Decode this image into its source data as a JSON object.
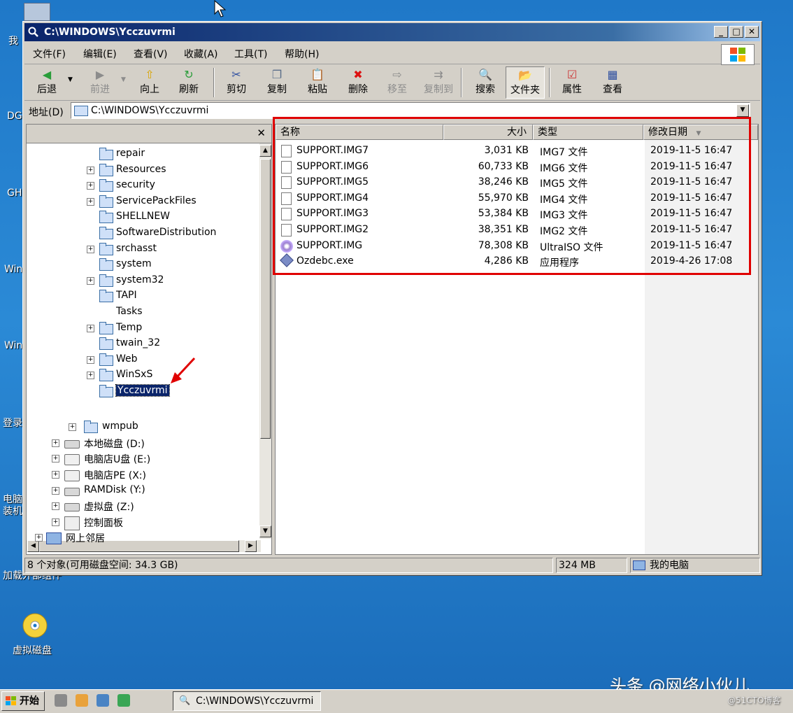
{
  "window": {
    "title": "C:\\WINDOWS\\Ycczuvrmi",
    "controls": {
      "minimize": "_",
      "maximize": "□",
      "close": "✕"
    }
  },
  "menu": [
    "文件(F)",
    "编辑(E)",
    "查看(V)",
    "收藏(A)",
    "工具(T)",
    "帮助(H)"
  ],
  "toolbar": {
    "back": "后退",
    "forward": "前进",
    "up": "向上",
    "refresh": "刷新",
    "cut": "剪切",
    "copy": "复制",
    "paste": "粘贴",
    "delete": "删除",
    "move_to": "移至",
    "copy_to": "复制到",
    "search": "搜索",
    "folders": "文件夹",
    "properties": "属性",
    "views": "查看"
  },
  "address": {
    "label": "地址(D)",
    "value": "C:\\WINDOWS\\Ycczuvrmi"
  },
  "tree": {
    "close": "✕",
    "items": [
      {
        "label": "repair",
        "expand": false
      },
      {
        "label": "Resources",
        "expand": true
      },
      {
        "label": "security",
        "expand": true
      },
      {
        "label": "ServicePackFiles",
        "expand": true
      },
      {
        "label": "SHELLNEW",
        "expand": false
      },
      {
        "label": "SoftwareDistribution",
        "expand": false
      },
      {
        "label": "srchasst",
        "expand": true
      },
      {
        "label": "system",
        "expand": false
      },
      {
        "label": "system32",
        "expand": true
      },
      {
        "label": "TAPI",
        "expand": false
      },
      {
        "label": "Tasks",
        "expand": false
      },
      {
        "label": "Temp",
        "expand": true
      },
      {
        "label": "twain_32",
        "expand": false
      },
      {
        "label": "Web",
        "expand": true
      },
      {
        "label": "WinSxS",
        "expand": true
      },
      {
        "label": "Ycczuvrmi",
        "expand": false,
        "selected": true
      }
    ],
    "wmpub": "wmpub",
    "drives": [
      "本地磁盘 (D:)",
      "电脑店U盘 (E:)",
      "电脑店PE (X:)",
      "RAMDisk (Y:)",
      "虚拟盘 (Z:)",
      "控制面板"
    ],
    "network": "网上邻居"
  },
  "list": {
    "columns": {
      "name": "名称",
      "size": "大小",
      "type": "类型",
      "modified": "修改日期"
    },
    "rows": [
      {
        "name": "SUPPORT.IMG7",
        "size": "3,031 KB",
        "type": "IMG7 文件",
        "modified": "2019-11-5 16:47",
        "icon": "file-icon"
      },
      {
        "name": "SUPPORT.IMG6",
        "size": "60,733 KB",
        "type": "IMG6 文件",
        "modified": "2019-11-5 16:47",
        "icon": "file-icon"
      },
      {
        "name": "SUPPORT.IMG5",
        "size": "38,246 KB",
        "type": "IMG5 文件",
        "modified": "2019-11-5 16:47",
        "icon": "file-icon"
      },
      {
        "name": "SUPPORT.IMG4",
        "size": "55,970 KB",
        "type": "IMG4 文件",
        "modified": "2019-11-5 16:47",
        "icon": "file-icon"
      },
      {
        "name": "SUPPORT.IMG3",
        "size": "53,384 KB",
        "type": "IMG3 文件",
        "modified": "2019-11-5 16:47",
        "icon": "file-icon"
      },
      {
        "name": "SUPPORT.IMG2",
        "size": "38,351 KB",
        "type": "IMG2 文件",
        "modified": "2019-11-5 16:47",
        "icon": "file-icon"
      },
      {
        "name": "SUPPORT.IMG",
        "size": "78,308 KB",
        "type": "UltraISO 文件",
        "modified": "2019-11-5 16:47",
        "icon": "iso-icon"
      },
      {
        "name": "Ozdebc.exe",
        "size": "4,286 KB",
        "type": "应用程序",
        "modified": "2019-4-26 17:08",
        "icon": "exe-icon"
      }
    ]
  },
  "status": {
    "objects": "8 个对象(可用磁盘空间: 34.3 GB)",
    "size": "324 MB",
    "location": "我的电脑"
  },
  "desktop": {
    "icon_label": "虚拟磁盘",
    "edge_labels": [
      "我",
      "DG",
      "GH",
      "Win",
      "Win",
      "登录",
      "电脑",
      "装机",
      "加载外部组件"
    ]
  },
  "taskbar": {
    "start": "开始",
    "task": "C:\\WINDOWS\\Ycczuvrmi"
  },
  "watermark": {
    "main": "头条 @网络小伙儿",
    "sub": "@51CTO博客"
  },
  "colors": {
    "annotation": "#e00000",
    "selection": "#0a246a",
    "titlebar": "#0a246a"
  }
}
